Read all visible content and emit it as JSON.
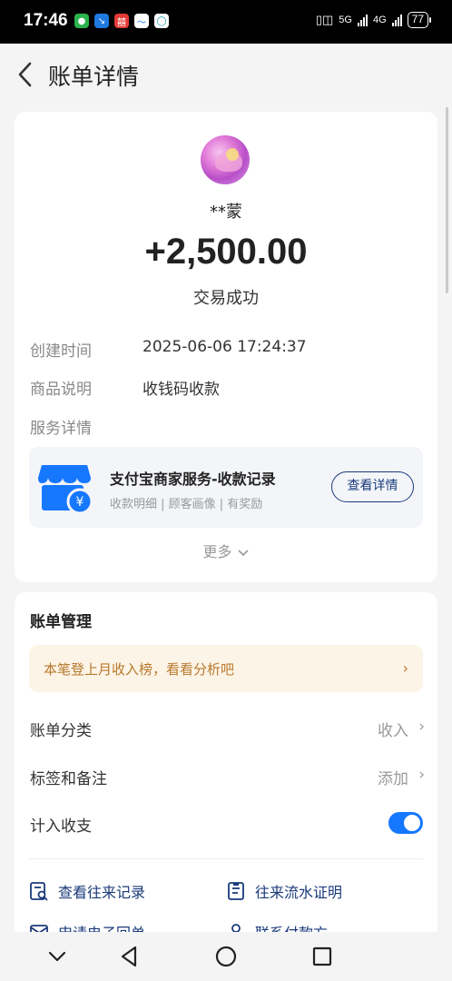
{
  "status_bar": {
    "time": "17:46",
    "network1": "5G",
    "network2": "4G",
    "battery": "77"
  },
  "header": {
    "title": "账单详情",
    "back_icon": "chevron-left-icon"
  },
  "transaction": {
    "nickname": "**蒙",
    "amount": "+2,500.00",
    "status": "交易成功"
  },
  "details": [
    {
      "label": "创建时间",
      "value": "2025-06-06 17:24:37"
    },
    {
      "label": "商品说明",
      "value": "收钱码收款"
    },
    {
      "label": "服务详情",
      "value": ""
    }
  ],
  "service": {
    "title": "支付宝商家服务-收款记录",
    "subtitle": "收款明细 | 顾客画像 | 有奖励",
    "button": "查看详情",
    "icon": "shop-yuan-icon",
    "color": "#1677ff"
  },
  "more_label": "更多",
  "management": {
    "title": "账单管理",
    "tip": "本笔登上月收入榜，看看分析吧",
    "rows": [
      {
        "label": "账单分类",
        "value": "收入"
      },
      {
        "label": "标签和备注",
        "value": "添加"
      },
      {
        "label": "计入收支",
        "toggle_on": true
      }
    ],
    "links": [
      {
        "label": "查看往来记录",
        "icon": "record-search-icon"
      },
      {
        "label": "往来流水证明",
        "icon": "document-icon"
      },
      {
        "label": "申请电子回单",
        "icon": "envelope-icon"
      },
      {
        "label": "联系付款方",
        "icon": "person-icon"
      }
    ]
  },
  "colors": {
    "accent": "#1677ff",
    "link": "#1a3a7a",
    "tip_text": "#b8782c",
    "tip_bg": "#fcf4e6"
  }
}
